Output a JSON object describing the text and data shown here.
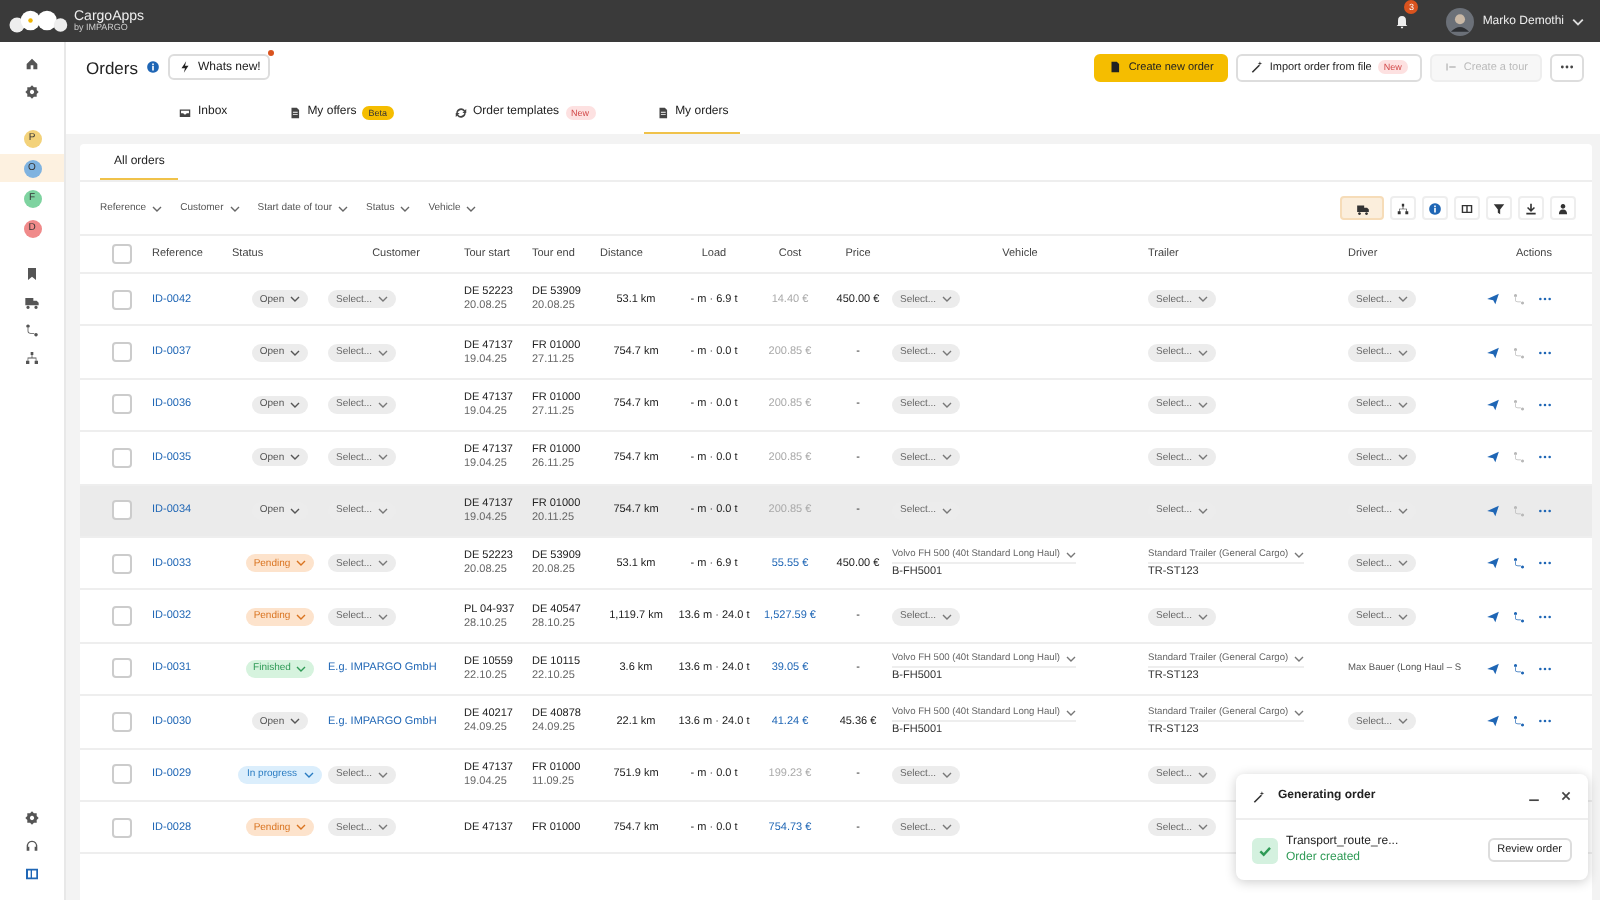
{
  "app": {
    "name": "CargoApps",
    "tagline": "by IMPARGO"
  },
  "sidebar": {
    "top": [
      {
        "kind": "home"
      },
      {
        "kind": "gear"
      }
    ],
    "apps": [
      {
        "letter": "P",
        "color": "#f3d27a",
        "selected": false
      },
      {
        "letter": "O",
        "color": "#7fb3e0",
        "selected": true
      },
      {
        "letter": "F",
        "color": "#7ed3a0",
        "selected": false
      },
      {
        "letter": "D",
        "color": "#f08a8a",
        "selected": false
      }
    ],
    "tools": [
      {
        "kind": "bookmark"
      },
      {
        "kind": "truck"
      },
      {
        "kind": "route"
      },
      {
        "kind": "network"
      }
    ],
    "bottom": [
      {
        "kind": "gear"
      },
      {
        "kind": "headset"
      },
      {
        "kind": "panel"
      }
    ]
  },
  "user": {
    "name": "Marko Demothi",
    "notifications": "3"
  },
  "page": {
    "title": "Orders",
    "whats_new": "Whats new!",
    "whats_new_unread": true
  },
  "actions": [
    {
      "kind": "primary",
      "label": "Create new order"
    },
    {
      "kind": "import",
      "label": "Import order from file",
      "badge": "New"
    },
    {
      "kind": "disabled",
      "label": "Create a tour"
    },
    {
      "kind": "more"
    }
  ],
  "tabs": [
    {
      "label": "Inbox",
      "selected": false
    },
    {
      "label": "My offers",
      "badge": "Beta",
      "selected": false
    },
    {
      "label": "Order templates",
      "badge": "New",
      "selected": false
    },
    {
      "label": "My orders",
      "selected": true
    }
  ],
  "subtabs": [
    {
      "label": "All orders",
      "selected": true
    }
  ],
  "filters": [
    "Reference",
    "Customer",
    "Start date of tour",
    "Status",
    "Vehicle"
  ],
  "toolbar": [
    {
      "kind": "truck",
      "selected": true
    },
    {
      "kind": "network",
      "selected": false
    },
    {
      "kind": "info",
      "selected": false
    },
    {
      "kind": "columns",
      "selected": false
    },
    {
      "kind": "filter",
      "selected": false
    },
    {
      "kind": "download",
      "selected": false
    },
    {
      "kind": "person",
      "selected": false
    }
  ],
  "table": {
    "select_all_checked": false,
    "columns": [
      "Reference",
      "Status",
      "Customer",
      "Tour start",
      "Tour end",
      "Distance",
      "Load",
      "Cost",
      "Price",
      "Vehicle",
      "Trailer",
      "Driver",
      "Actions"
    ],
    "rows": [
      {
        "checked": false,
        "hovered": false,
        "ref": "ID-0042",
        "status": {
          "kind": "open",
          "label": "Open"
        },
        "customer": {
          "kind": "select",
          "value": "Select..."
        },
        "start": [
          "DE 52223",
          "20.08.25"
        ],
        "end": [
          "DE 53909",
          "20.08.25"
        ],
        "distance": "53.1 km",
        "load": "- m · 6.9 t",
        "cost": {
          "kind": "muted",
          "value": "14.40 €"
        },
        "price": "450.00 €",
        "vehicle": {
          "kind": "select",
          "value": "Select..."
        },
        "trailer": {
          "kind": "select",
          "value": "Select..."
        },
        "driver": {
          "kind": "select",
          "value": "Select..."
        },
        "actions": {
          "route_enabled": false
        }
      },
      {
        "checked": false,
        "hovered": false,
        "ref": "ID-0037",
        "status": {
          "kind": "open",
          "label": "Open"
        },
        "customer": {
          "kind": "select",
          "value": "Select..."
        },
        "start": [
          "DE 47137",
          "19.04.25"
        ],
        "end": [
          "FR 01000",
          "27.11.25"
        ],
        "distance": "754.7 km",
        "load": "- m · 0.0 t",
        "cost": {
          "kind": "muted",
          "value": "200.85 €"
        },
        "price": "-",
        "vehicle": {
          "kind": "select",
          "value": "Select..."
        },
        "trailer": {
          "kind": "select",
          "value": "Select..."
        },
        "driver": {
          "kind": "select",
          "value": "Select..."
        },
        "actions": {
          "route_enabled": false
        }
      },
      {
        "checked": false,
        "hovered": false,
        "ref": "ID-0036",
        "status": {
          "kind": "open",
          "label": "Open"
        },
        "customer": {
          "kind": "select",
          "value": "Select..."
        },
        "start": [
          "DE 47137",
          "19.04.25"
        ],
        "end": [
          "FR 01000",
          "27.11.25"
        ],
        "distance": "754.7 km",
        "load": "- m · 0.0 t",
        "cost": {
          "kind": "muted",
          "value": "200.85 €"
        },
        "price": "-",
        "vehicle": {
          "kind": "select",
          "value": "Select..."
        },
        "trailer": {
          "kind": "select",
          "value": "Select..."
        },
        "driver": {
          "kind": "select",
          "value": "Select..."
        },
        "actions": {
          "route_enabled": false
        }
      },
      {
        "checked": false,
        "hovered": false,
        "ref": "ID-0035",
        "status": {
          "kind": "open",
          "label": "Open"
        },
        "customer": {
          "kind": "select",
          "value": "Select..."
        },
        "start": [
          "DE 47137",
          "19.04.25"
        ],
        "end": [
          "FR 01000",
          "26.11.25"
        ],
        "distance": "754.7 km",
        "load": "- m · 0.0 t",
        "cost": {
          "kind": "muted",
          "value": "200.85 €"
        },
        "price": "-",
        "vehicle": {
          "kind": "select",
          "value": "Select..."
        },
        "trailer": {
          "kind": "select",
          "value": "Select..."
        },
        "driver": {
          "kind": "select",
          "value": "Select..."
        },
        "actions": {
          "route_enabled": false
        }
      },
      {
        "checked": false,
        "hovered": true,
        "ref": "ID-0034",
        "status": {
          "kind": "open",
          "label": "Open"
        },
        "customer": {
          "kind": "select",
          "value": "Select..."
        },
        "start": [
          "DE 47137",
          "19.04.25"
        ],
        "end": [
          "FR 01000",
          "20.11.25"
        ],
        "distance": "754.7 km",
        "load": "- m · 0.0 t",
        "cost": {
          "kind": "muted",
          "value": "200.85 €"
        },
        "price": "-",
        "vehicle": {
          "kind": "select",
          "value": "Select..."
        },
        "trailer": {
          "kind": "select",
          "value": "Select..."
        },
        "driver": {
          "kind": "select",
          "value": "Select..."
        },
        "actions": {
          "route_enabled": false
        }
      },
      {
        "checked": false,
        "hovered": false,
        "ref": "ID-0033",
        "status": {
          "kind": "pending",
          "label": "Pending"
        },
        "customer": {
          "kind": "select",
          "value": "Select..."
        },
        "start": [
          "DE 52223",
          "20.08.25"
        ],
        "end": [
          "DE 53909",
          "20.08.25"
        ],
        "distance": "53.1 km",
        "load": "- m · 6.9 t",
        "cost": {
          "kind": "link",
          "value": "55.55 €"
        },
        "price": "450.00 €",
        "vehicle": {
          "kind": "assigned",
          "value": "Volvo FH 500 (40t Standard Long Haul)",
          "plate": "B-FH5001"
        },
        "trailer": {
          "kind": "assigned",
          "value": "Standard Trailer (General Cargo)",
          "plate": "TR-ST123"
        },
        "driver": {
          "kind": "select",
          "value": "Select..."
        },
        "actions": {
          "route_enabled": true
        }
      },
      {
        "checked": false,
        "hovered": false,
        "ref": "ID-0032",
        "status": {
          "kind": "pending",
          "label": "Pending"
        },
        "customer": {
          "kind": "select",
          "value": "Select..."
        },
        "start": [
          "PL 04-937",
          "28.10.25"
        ],
        "end": [
          "DE 40547",
          "28.10.25"
        ],
        "distance": "1,119.7 km",
        "load": "13.6 m · 24.0 t",
        "cost": {
          "kind": "link",
          "value": "1,527.59 €"
        },
        "price": "-",
        "vehicle": {
          "kind": "select",
          "value": "Select..."
        },
        "trailer": {
          "kind": "select",
          "value": "Select..."
        },
        "driver": {
          "kind": "select",
          "value": "Select..."
        },
        "actions": {
          "route_enabled": true
        }
      },
      {
        "checked": false,
        "hovered": false,
        "ref": "ID-0031",
        "status": {
          "kind": "finished",
          "label": "Finished"
        },
        "customer": {
          "kind": "link",
          "value": "E.g. IMPARGO GmbH"
        },
        "start": [
          "DE 10559",
          "22.10.25"
        ],
        "end": [
          "DE 10115",
          "22.10.25"
        ],
        "distance": "3.6 km",
        "load": "13.6 m · 24.0 t",
        "cost": {
          "kind": "link",
          "value": "39.05 €"
        },
        "price": "-",
        "vehicle": {
          "kind": "assigned",
          "value": "Volvo FH 500 (40t Standard Long Haul)",
          "plate": "B-FH5001"
        },
        "trailer": {
          "kind": "assigned",
          "value": "Standard Trailer (General Cargo)",
          "plate": "TR-ST123"
        },
        "driver": {
          "kind": "assigned",
          "value": "Max Bauer (Long Haul – S"
        },
        "actions": {
          "route_enabled": true
        }
      },
      {
        "checked": false,
        "hovered": false,
        "ref": "ID-0030",
        "status": {
          "kind": "open",
          "label": "Open"
        },
        "customer": {
          "kind": "link",
          "value": "E.g. IMPARGO GmbH"
        },
        "start": [
          "DE 40217",
          "24.09.25"
        ],
        "end": [
          "DE 40878",
          "24.09.25"
        ],
        "distance": "22.1 km",
        "load": "13.6 m · 24.0 t",
        "cost": {
          "kind": "link",
          "value": "41.24 €"
        },
        "price": "45.36 €",
        "vehicle": {
          "kind": "assigned",
          "value": "Volvo FH 500 (40t Standard Long Haul)",
          "plate": "B-FH5001"
        },
        "trailer": {
          "kind": "assigned",
          "value": "Standard Trailer (General Cargo)",
          "plate": "TR-ST123"
        },
        "driver": {
          "kind": "select",
          "value": "Select..."
        },
        "actions": {
          "route_enabled": true
        }
      },
      {
        "checked": false,
        "hovered": false,
        "ref": "ID-0029",
        "status": {
          "kind": "in_progress",
          "label": "In progress"
        },
        "customer": {
          "kind": "select",
          "value": "Select..."
        },
        "start": [
          "DE 47137",
          "19.04.25"
        ],
        "end": [
          "FR 01000",
          "11.09.25"
        ],
        "distance": "751.9 km",
        "load": "- m · 0.0 t",
        "cost": {
          "kind": "muted",
          "value": "199.23 €"
        },
        "price": "-",
        "vehicle": {
          "kind": "select",
          "value": "Select..."
        },
        "trailer": {
          "kind": "select",
          "value": "Select..."
        }
      },
      {
        "checked": false,
        "hovered": false,
        "ref": "ID-0028",
        "status": {
          "kind": "pending",
          "label": "Pending"
        },
        "customer": {
          "kind": "select",
          "value": "Select..."
        },
        "start": [
          "DE 47137"
        ],
        "end": [
          "FR 01000"
        ],
        "distance": "754.7 km",
        "load": "- m · 0.0 t",
        "cost": {
          "kind": "link",
          "value": "754.73 €"
        },
        "price": "-",
        "vehicle": {
          "kind": "select",
          "value": "Select..."
        },
        "trailer": {
          "kind": "select",
          "value": "Select..."
        }
      }
    ]
  },
  "popup": {
    "title": "Generating order",
    "file": "Transport_route_re...",
    "status": "Order created",
    "button": "Review order"
  }
}
